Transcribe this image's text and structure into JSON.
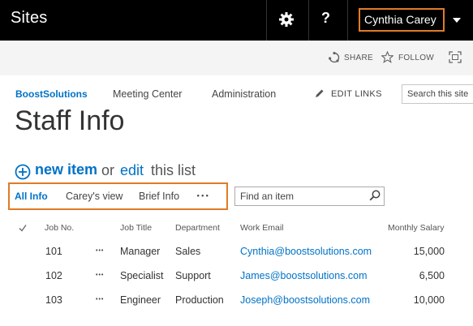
{
  "suite": {
    "title": "Sites",
    "user_name": "Cynthia Carey",
    "help_label": "?"
  },
  "ribbon": {
    "share_label": "SHARE",
    "follow_label": "FOLLOW"
  },
  "nav": {
    "home": "BoostSolutions",
    "items": [
      "Meeting Center",
      "Administration"
    ],
    "edit_links": "EDIT LINKS",
    "search_placeholder": "Search this site"
  },
  "page": {
    "title": "Staff Info"
  },
  "new_item": {
    "new_label": "new item",
    "or_label": "or",
    "edit_label": "edit",
    "suffix": "this list"
  },
  "views": {
    "tabs": [
      "All Info",
      "Carey's view",
      "Brief Info"
    ],
    "more": "•••",
    "find_placeholder": "Find an item"
  },
  "table": {
    "columns": [
      "Job No.",
      "Job Title",
      "Department",
      "Work Email",
      "Monthly Salary"
    ],
    "rows": [
      {
        "job_no": "101",
        "menu": "•••",
        "job_title": "Manager",
        "department": "Sales",
        "email": "Cynthia@boostsolutions.com",
        "salary": "15,000"
      },
      {
        "job_no": "102",
        "menu": "•••",
        "job_title": "Specialist",
        "department": "Support",
        "email": "James@boostsolutions.com",
        "salary": "6,500"
      },
      {
        "job_no": "103",
        "menu": "•••",
        "job_title": "Engineer",
        "department": "Production",
        "email": "Joseph@boostsolutions.com",
        "salary": "10,000"
      }
    ]
  },
  "colors": {
    "accent": "#0072c6",
    "highlight_border": "#e07b26",
    "suite_bg": "#000000"
  }
}
